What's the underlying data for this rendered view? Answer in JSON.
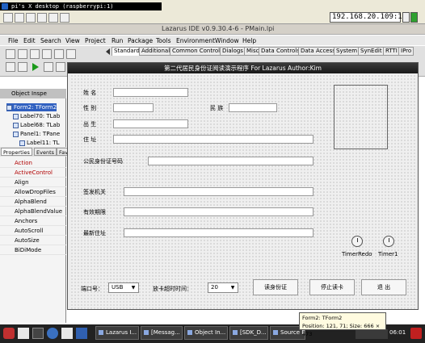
{
  "vnc": {
    "title": "pi's X desktop (raspberrypi:1)",
    "ip": "192.168.20.109:1"
  },
  "ide": {
    "title": "Lazarus IDE v0.9.30.4-6 - PMain.lpi"
  },
  "menu": [
    "File",
    "Edit",
    "Search",
    "View",
    "Project",
    "Run",
    "Package",
    "Tools",
    "Environment",
    "Window",
    "Help"
  ],
  "palette_tabs": [
    "Standard",
    "Additional",
    "Common Controls",
    "Dialogs",
    "Misc",
    "Data Controls",
    "Data Access",
    "System",
    "SynEdit",
    "RTTI",
    "IPro"
  ],
  "object_inspector": {
    "title": "Object Inspe",
    "tree": [
      "Form2: TForm2",
      "Label70: TLab",
      "Label68: TLab",
      "Panel1: TPane",
      "Label11: TL"
    ],
    "tabs": [
      "Properties",
      "Events",
      "Fav"
    ],
    "properties": [
      "Action",
      "ActiveControl",
      "Align",
      "AllowDropFiles",
      "AlphaBlend",
      "AlphaBlendValue",
      "Anchors",
      "AutoScroll",
      "AutoSize",
      "BiDiMode"
    ]
  },
  "form": {
    "title": "第二代居民身份证阅读演示程序  For Lazarus Author:Kim",
    "labels": {
      "name": "姓 名",
      "sex": "性 别",
      "nation": "民 族",
      "birth": "出 生",
      "address": "住 址",
      "id_number": "公民身份证号码",
      "issuer": "签发机关",
      "valid": "有效期限",
      "new_address": "最新住址",
      "port": "端口号：",
      "timeout": "放卡超时时间："
    },
    "port_value": "USB",
    "timeout_value": "20",
    "buttons": {
      "read": "读身份证",
      "stop": "停止读卡",
      "exit": "退 出"
    },
    "timers": [
      "TimerRedo",
      "Timer1"
    ]
  },
  "taskbar": [
    "Lazarus I...",
    "[Messag...",
    "Object In...",
    "[SDK_D...",
    "Source E..."
  ],
  "clock": "06:01",
  "tooltip": {
    "line1": "Form2: TForm2",
    "line2": "Position: 121, 71; Size: 666 × 473"
  }
}
